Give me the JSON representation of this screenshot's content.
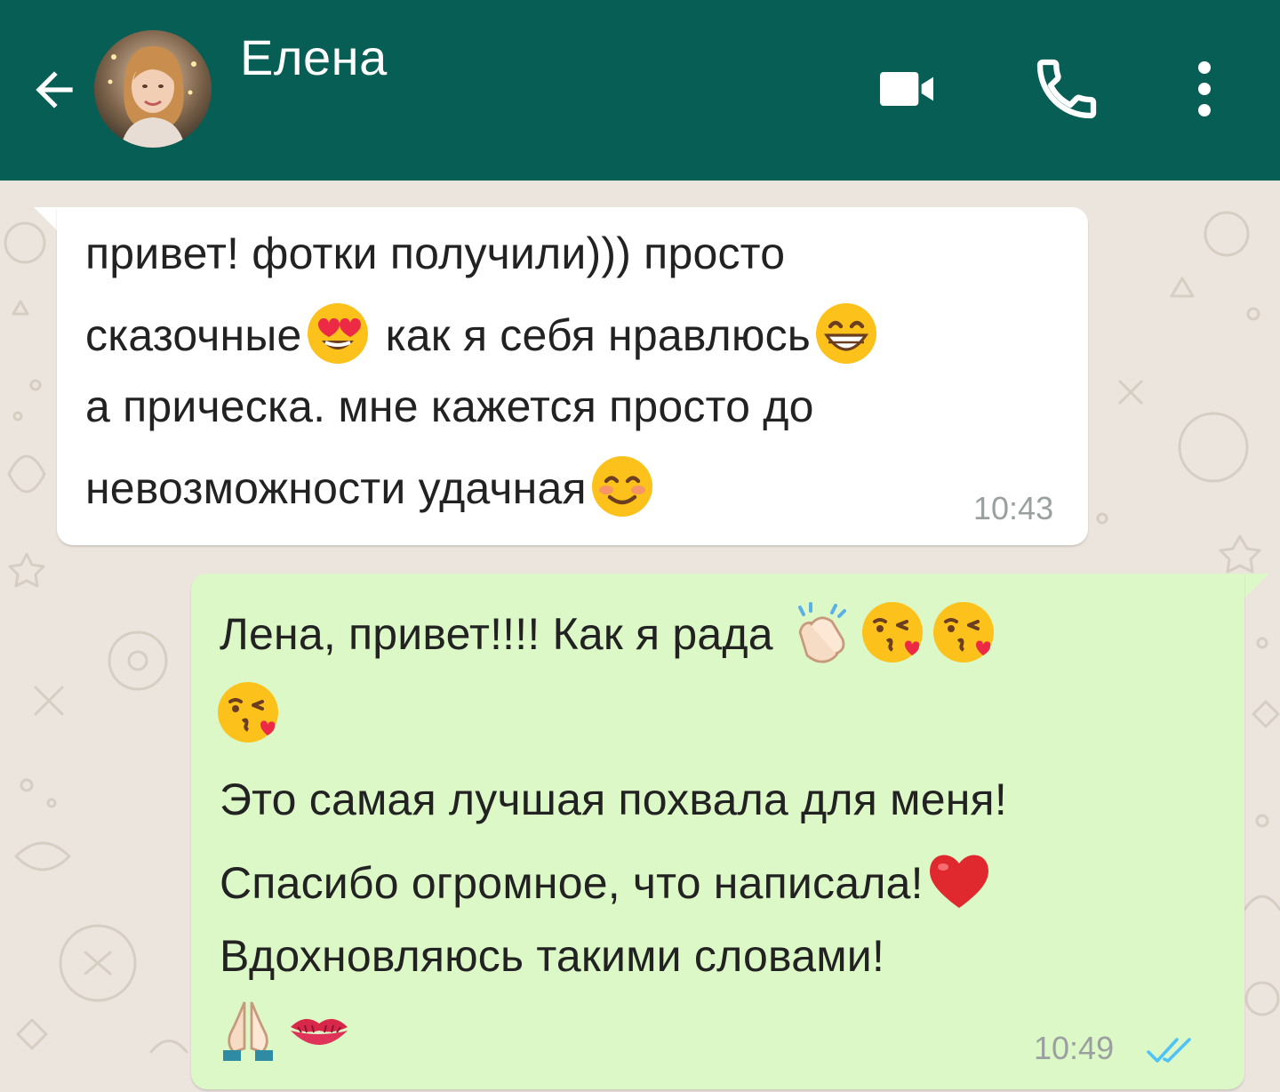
{
  "header": {
    "contact_name": "Елена",
    "back_icon": "arrow-left-icon",
    "avatar_icon": "contact-avatar",
    "video_icon": "video-camera-icon",
    "call_icon": "phone-icon",
    "menu_icon": "more-vertical-icon",
    "bg_color": "#075e54"
  },
  "chat": {
    "wallpaper_color": "#ece5dd",
    "messages": [
      {
        "direction": "incoming",
        "bubble_color": "#ffffff",
        "lines": [
          {
            "parts": [
              "привет! фотки получили))) просто"
            ]
          },
          {
            "parts": [
              "сказочные",
              " как я себя нравлюсь"
            ],
            "emojis": [
              "heart-eyes-emoji",
              "grinning-emoji"
            ]
          },
          {
            "parts": [
              "а прическа. мне кажется просто до"
            ]
          },
          {
            "parts": [
              "невозможности удачная"
            ],
            "emojis": [
              "smiling-blush-emoji"
            ]
          }
        ],
        "time": "10:43"
      },
      {
        "direction": "outgoing",
        "bubble_color": "#dcf8c6",
        "lines": [
          {
            "parts": [
              "Лена, привет!!!! Как я рада "
            ],
            "emojis": [
              "clapping-hands-emoji",
              "kiss-wink-emoji",
              "kiss-wink-emoji"
            ]
          },
          {
            "parts": [
              ""
            ],
            "emojis": [
              "kiss-wink-emoji"
            ]
          },
          {
            "parts": [
              "Это самая лучшая похвала для меня!"
            ]
          },
          {
            "parts": [
              "Спасибо огромное, что написала!"
            ],
            "emojis": [
              "red-heart-emoji"
            ]
          },
          {
            "parts": [
              "Вдохновляюсь такими словами!"
            ]
          },
          {
            "parts": [
              ""
            ],
            "emojis": [
              "folded-hands-emoji",
              "kiss-mark-emoji"
            ]
          }
        ],
        "time": "10:49",
        "status_icon": "double-check-read-icon",
        "status_color": "#4fc3f7"
      }
    ]
  }
}
